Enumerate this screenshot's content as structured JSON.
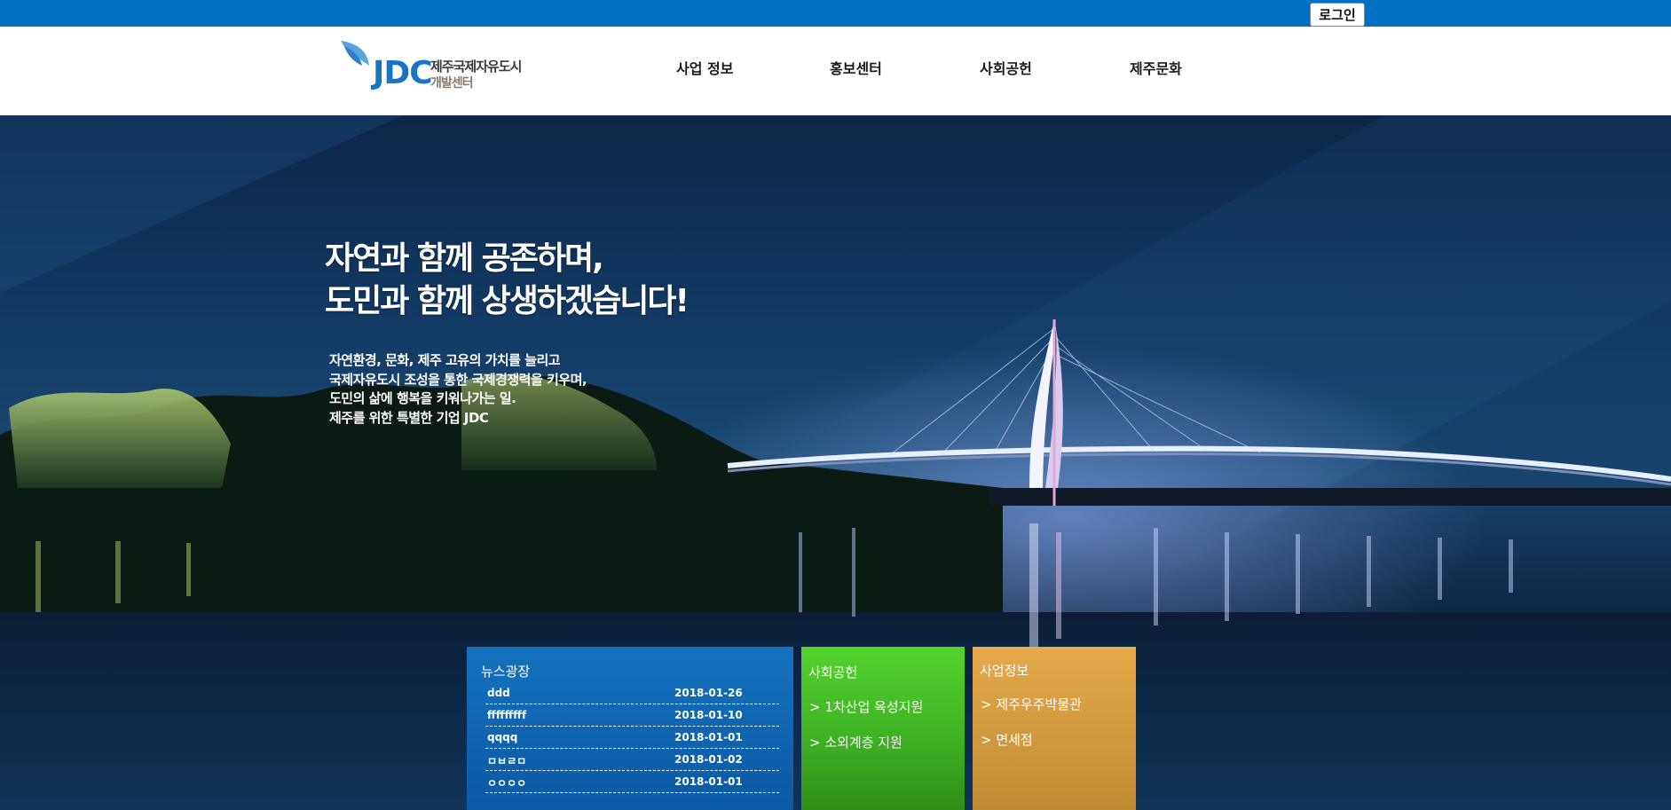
{
  "topbar": {
    "login_label": "로그인"
  },
  "logo": {
    "mark": "JDC",
    "line1": "제주국제자유도시",
    "line2": "개발센터"
  },
  "nav": [
    {
      "label": "사업 정보"
    },
    {
      "label": "홍보센터"
    },
    {
      "label": "사회공헌"
    },
    {
      "label": "제주문화"
    }
  ],
  "hero": {
    "headline_line1": "자연과 함께 공존하며,",
    "headline_line2": "도민과 함께 상생하겠습니다!",
    "desc": [
      "자연환경, 문화, 제주 고유의 가치를 늘리고",
      "국제자유도시 조성을 통한 국제경쟁력을 키우며,",
      "도민의 삶에 행복을 키워나가는 일.",
      "제주를 위한 특별한 기업 JDC"
    ]
  },
  "news": {
    "title": "뉴스광장",
    "items": [
      {
        "title": "ddd",
        "date": "2018-01-26"
      },
      {
        "title": "fffffffff",
        "date": "2018-01-10"
      },
      {
        "title": "qqqq",
        "date": "2018-01-01"
      },
      {
        "title": "ㅁㅂㄹㅁ",
        "date": "2018-01-02"
      },
      {
        "title": "ㅇㅇㅇㅇ",
        "date": "2018-01-01"
      }
    ]
  },
  "social": {
    "title": "사회공헌",
    "links": [
      "> 1차산업 육성지원",
      "> 소외계층 지원"
    ]
  },
  "business": {
    "title": "사업정보",
    "links": [
      "> 제주우주박물관",
      "> 면세점"
    ]
  },
  "colors": {
    "topbar": "#0070c4",
    "news_panel": "#1678c8",
    "social_panel": "#48c428",
    "business_panel": "#e9a646"
  }
}
